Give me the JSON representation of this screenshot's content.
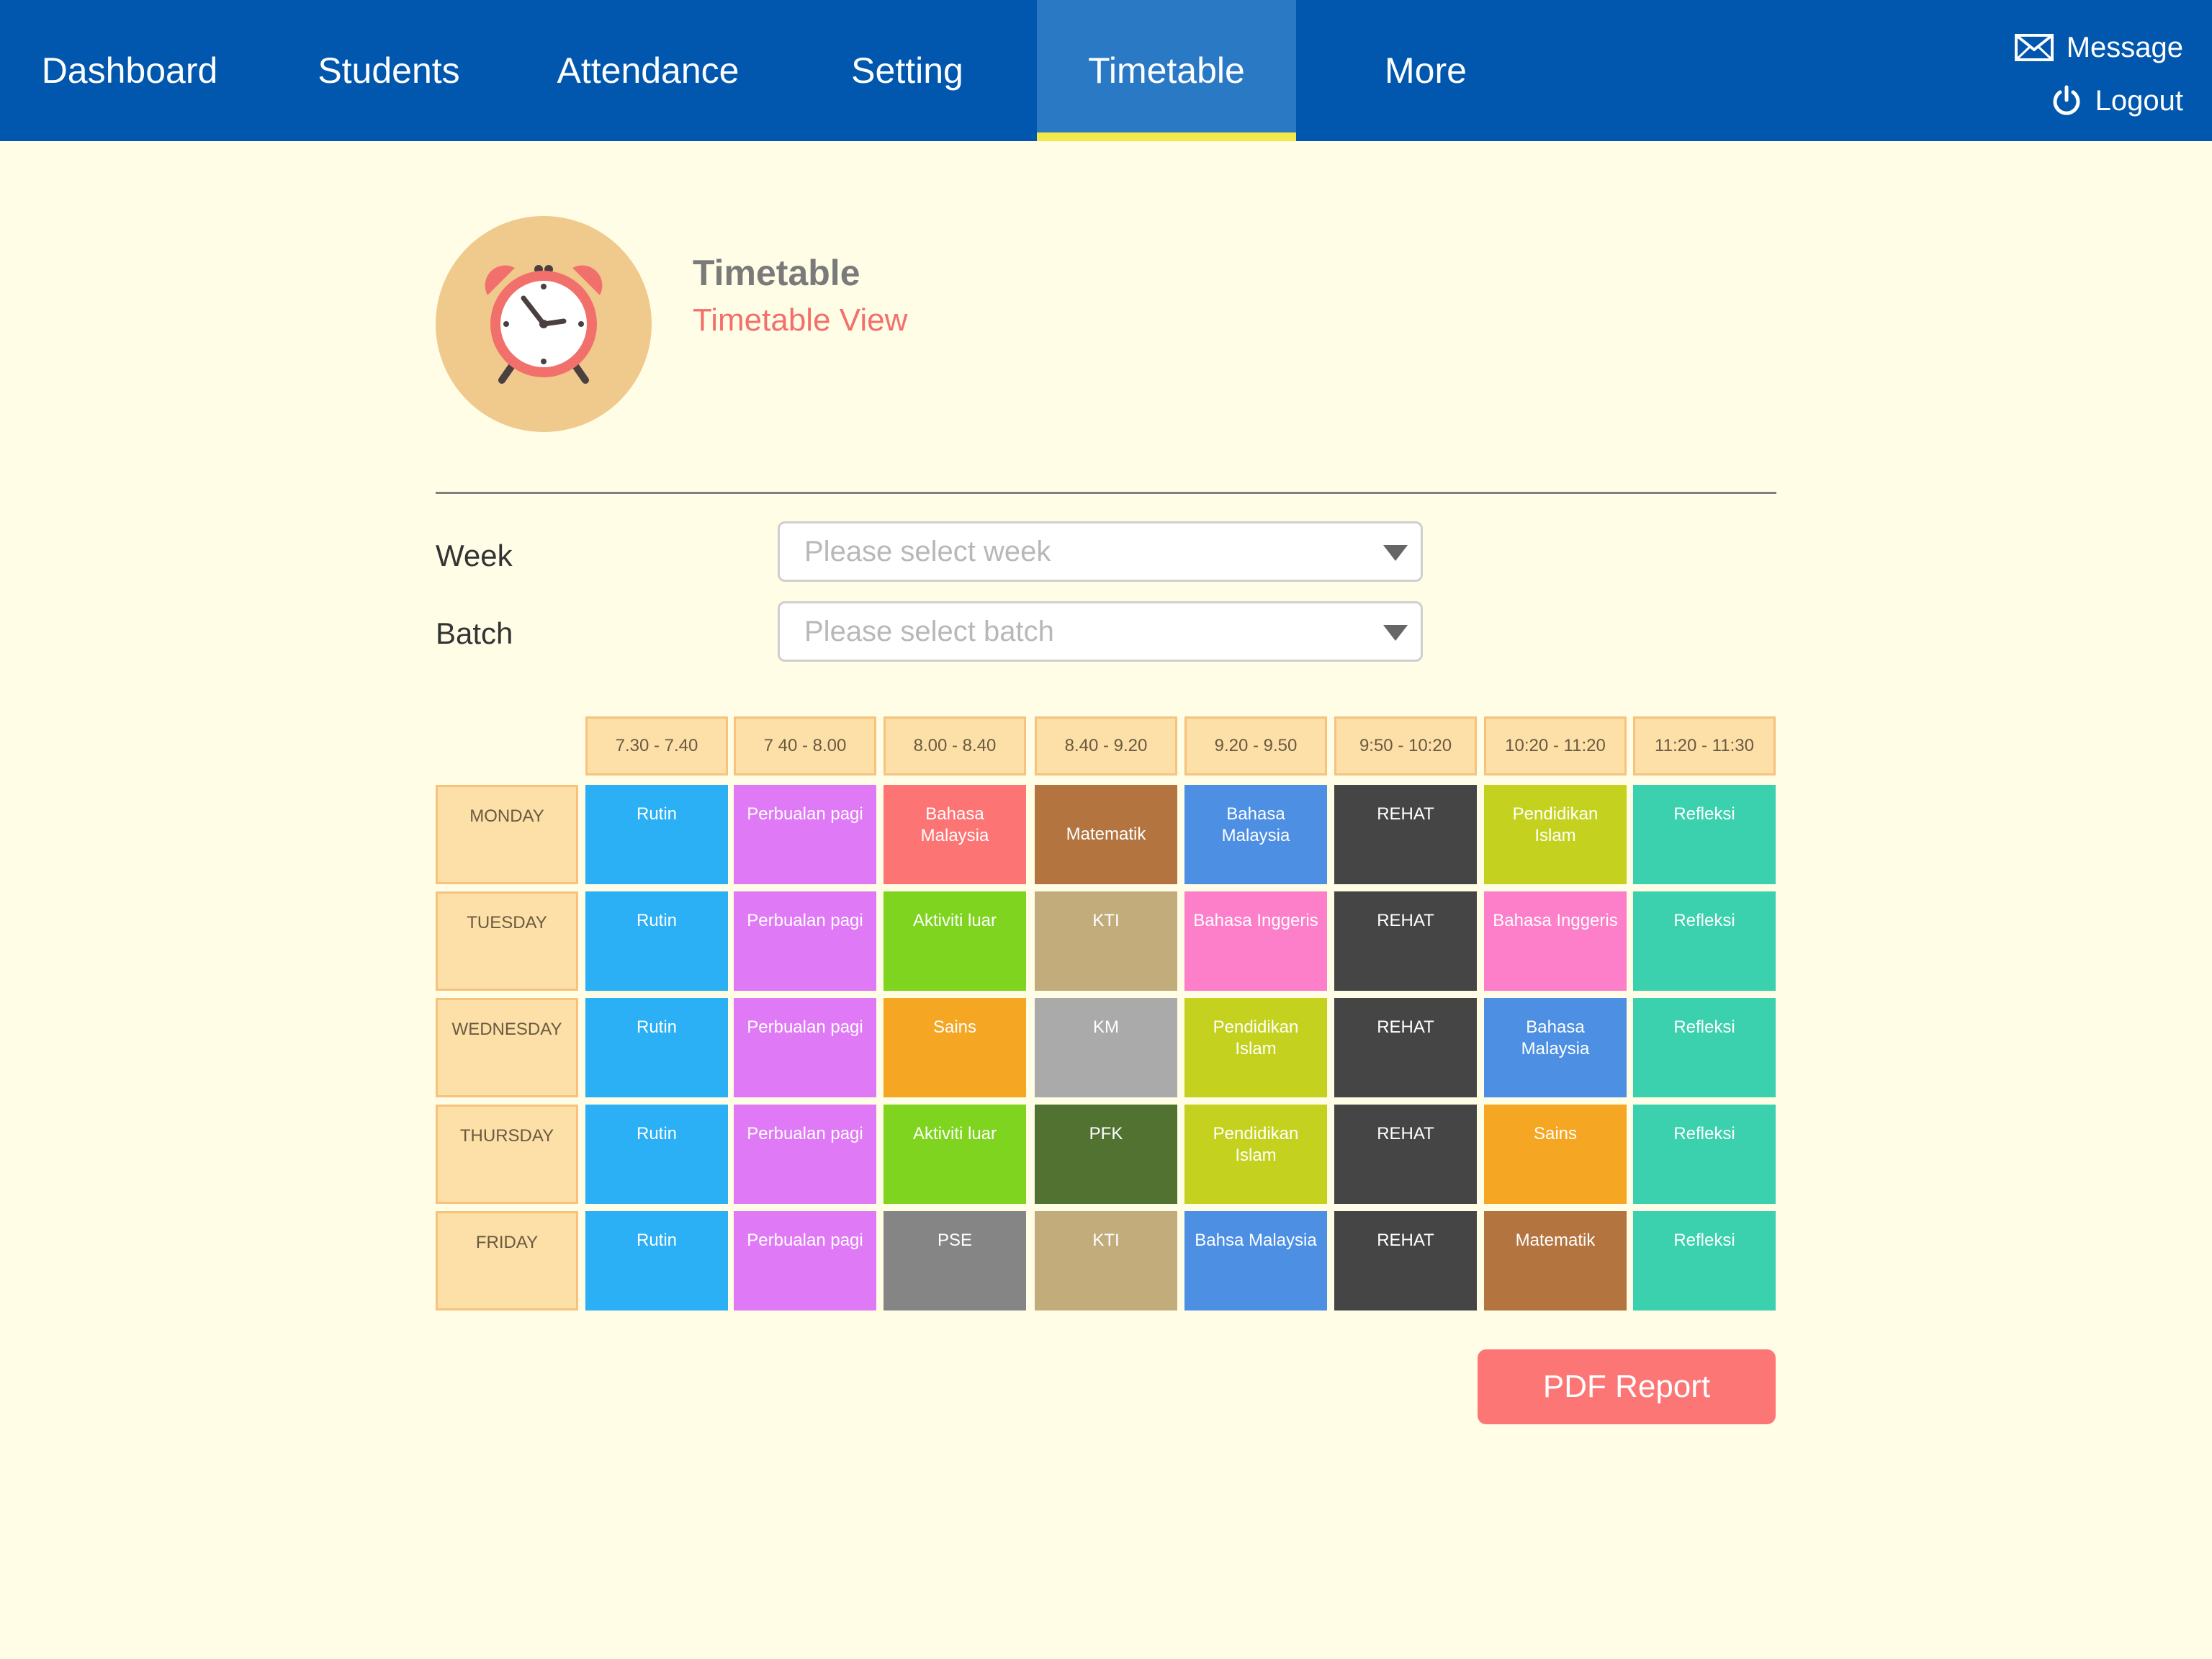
{
  "nav": {
    "items": [
      {
        "label": "Dashboard",
        "active": false
      },
      {
        "label": "Students",
        "active": false
      },
      {
        "label": "Attendance",
        "active": false
      },
      {
        "label": "Setting",
        "active": false
      },
      {
        "label": "Timetable",
        "active": true
      },
      {
        "label": "More",
        "active": false
      }
    ],
    "message_label": "Message",
    "logout_label": "Logout"
  },
  "header": {
    "title": "Timetable",
    "subtitle": "Timetable View"
  },
  "filters": {
    "week": {
      "label": "Week",
      "placeholder": "Please select week"
    },
    "batch": {
      "label": "Batch",
      "placeholder": "Please select batch"
    }
  },
  "timetable": {
    "times": [
      "7.30 - 7.40",
      "7 40 - 8.00",
      "8.00 - 8.40",
      "8.40 - 9.20",
      "9.20 - 9.50",
      "9:50 - 10:20",
      "10:20 - 11:20",
      "11:20 - 11:30"
    ],
    "days": [
      {
        "day": "MONDAY",
        "slots": [
          {
            "text": "Rutin",
            "color": "#2baff5"
          },
          {
            "text": "Perbualan pagi",
            "color": "#df79f5"
          },
          {
            "text": "Bahasa Malaysia",
            "color": "#fc7474"
          },
          {
            "text": "Matematik",
            "color": "#b37440"
          },
          {
            "text": "Bahasa Malaysia",
            "color": "#4c8fe3"
          },
          {
            "text": "REHAT",
            "color": "#454545"
          },
          {
            "text": "Pendidikan Islam",
            "color": "#c4d21f"
          },
          {
            "text": "Refleksi",
            "color": "#3cd1ae"
          }
        ]
      },
      {
        "day": "TUESDAY",
        "slots": [
          {
            "text": "Rutin",
            "color": "#2baff5"
          },
          {
            "text": "Perbualan pagi",
            "color": "#df79f5"
          },
          {
            "text": "Aktiviti luar",
            "color": "#7ed41e"
          },
          {
            "text": "KTI",
            "color": "#c2ac7c"
          },
          {
            "text": "Bahasa Inggeris",
            "color": "#fd7ec9"
          },
          {
            "text": "REHAT",
            "color": "#454545"
          },
          {
            "text": "Bahasa Inggeris",
            "color": "#fd7ec9"
          },
          {
            "text": "Refleksi",
            "color": "#3cd1ae"
          }
        ]
      },
      {
        "day": "WEDNESDAY",
        "slots": [
          {
            "text": "Rutin",
            "color": "#2baff5"
          },
          {
            "text": "Perbualan pagi",
            "color": "#df79f5"
          },
          {
            "text": "Sains",
            "color": "#f5a623"
          },
          {
            "text": "KM",
            "color": "#aaaaaa"
          },
          {
            "text": "Pendidikan Islam",
            "color": "#c4d21f"
          },
          {
            "text": "REHAT",
            "color": "#454545"
          },
          {
            "text": "Bahasa Malaysia",
            "color": "#4c8fe3"
          },
          {
            "text": "Refleksi",
            "color": "#3cd1ae"
          }
        ]
      },
      {
        "day": "THURSDAY",
        "slots": [
          {
            "text": "Rutin",
            "color": "#2baff5"
          },
          {
            "text": "Perbualan pagi",
            "color": "#df79f5"
          },
          {
            "text": "Aktiviti luar",
            "color": "#7ed41e"
          },
          {
            "text": "PFK",
            "color": "#527232"
          },
          {
            "text": "Pendidikan Islam",
            "color": "#c4d21f"
          },
          {
            "text": "REHAT",
            "color": "#454545"
          },
          {
            "text": "Sains",
            "color": "#f5a623"
          },
          {
            "text": "Refleksi",
            "color": "#3cd1ae"
          }
        ]
      },
      {
        "day": "FRIDAY",
        "slots": [
          {
            "text": "Rutin",
            "color": "#2baff5"
          },
          {
            "text": "Perbualan pagi",
            "color": "#df79f5"
          },
          {
            "text": "PSE",
            "color": "#858585"
          },
          {
            "text": "KTI",
            "color": "#c2ac7c"
          },
          {
            "text": "Bahsa Malaysia",
            "color": "#4c8fe3"
          },
          {
            "text": "REHAT",
            "color": "#454545"
          },
          {
            "text": "Matematik",
            "color": "#b37440"
          },
          {
            "text": "Refleksi",
            "color": "#3cd1ae"
          }
        ]
      }
    ]
  },
  "actions": {
    "pdf_report_label": "PDF Report"
  },
  "icons": {
    "header_icon": "alarm-clock-icon",
    "message_icon": "envelope-icon",
    "logout_icon": "power-icon"
  }
}
